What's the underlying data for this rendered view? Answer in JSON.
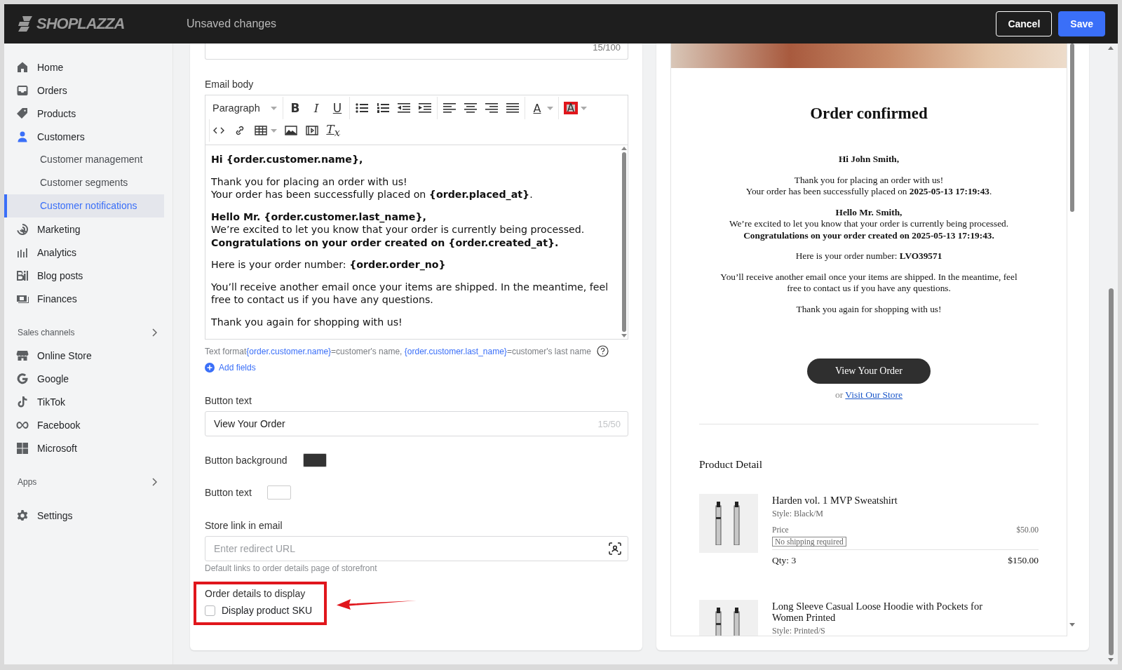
{
  "header": {
    "logo": "SHOPLAZZA",
    "status": "Unsaved changes",
    "buttons": [
      {
        "label": "Cancel",
        "kind": "secondary"
      },
      {
        "label": "Save",
        "kind": "primary"
      }
    ]
  },
  "sidebar": {
    "items": [
      {
        "label": "Home",
        "selected": false,
        "expanded": false
      },
      {
        "label": "Orders",
        "selected": false,
        "expanded": false
      },
      {
        "label": "Products",
        "selected": false,
        "expanded": false
      },
      {
        "label": "Customers",
        "selected": false,
        "expanded": true,
        "children": [
          {
            "label": "Customer management",
            "selected": false
          },
          {
            "label": "Customer segments",
            "selected": false
          },
          {
            "label": "Customer notifications",
            "selected": true
          }
        ]
      },
      {
        "label": "Marketing",
        "selected": false,
        "expanded": false
      },
      {
        "label": "Analytics",
        "selected": false,
        "expanded": false
      },
      {
        "label": "Blog posts",
        "selected": false,
        "expanded": false
      },
      {
        "label": "Finances",
        "selected": false,
        "expanded": false
      }
    ],
    "sections": [
      {
        "title": "Sales channels",
        "items": [
          {
            "label": "Online Store",
            "selected": false
          },
          {
            "label": "Google",
            "selected": false
          },
          {
            "label": "TikTok",
            "selected": false
          },
          {
            "label": "Facebook",
            "selected": false
          },
          {
            "label": "Microsoft",
            "selected": false
          }
        ]
      },
      {
        "title": "Apps"
      }
    ],
    "settings": {
      "label": "Settings",
      "selected": false
    }
  },
  "form": {
    "subject_counter": "15/100",
    "email_body_label": "Email body",
    "toolbar": {
      "block_format": "Paragraph",
      "groups": [
        [
          {
            "kind": "bold",
            "label": "B"
          },
          {
            "kind": "italic",
            "label": "I"
          },
          {
            "kind": "underline",
            "label": "U"
          }
        ],
        [
          {
            "kind": "bullets"
          },
          {
            "kind": "numbers"
          },
          {
            "kind": "outdent"
          },
          {
            "kind": "indent"
          }
        ],
        [
          {
            "kind": "align-left"
          },
          {
            "kind": "align-center"
          },
          {
            "kind": "align-right"
          },
          {
            "kind": "justify"
          }
        ],
        [
          {
            "kind": "text-color",
            "label": "A",
            "dropdown": true
          }
        ],
        [
          {
            "kind": "highlight",
            "label": "A",
            "dropdown": true
          }
        ]
      ],
      "second_row": [
        {
          "kind": "code"
        },
        {
          "kind": "link"
        },
        {
          "kind": "table",
          "dropdown": true
        },
        {
          "kind": "image"
        },
        {
          "kind": "video"
        },
        {
          "kind": "clear",
          "label": "T$_{x}$"
        }
      ]
    },
    "body": [
      [
        {
          "text": "Hi {order.customer.name},",
          "bold": true
        }
      ],
      [
        {
          "text": "Thank you for placing an order with us!",
          "bold": false
        },
        {
          "text": "Your order has been successfully placed on **{order.placed_at}**.",
          "bold": false
        }
      ],
      [
        {
          "text": "Hello Mr. {order.customer.last_name},",
          "bold": true
        },
        {
          "text": "We’re excited to let you know that your order is currently being processed.",
          "bold": false
        },
        {
          "text": "Congratulations on your order created on {order.created_at}.",
          "bold": true
        }
      ],
      [
        {
          "text": "Here is your order number: **{order.order_no}**",
          "bold": false
        }
      ],
      [
        {
          "text": "You’ll receive another email once your items are shipped. In the meantime, feel free to contact us if you have any questions.",
          "bold": false
        }
      ],
      [
        {
          "text": "Thank you again for shopping with us!",
          "bold": false
        }
      ]
    ],
    "format_hint": [
      {
        "text": "Text format",
        "kind": "plain"
      },
      {
        "text": "{order.customer.name}",
        "kind": "variable"
      },
      {
        "text": "=customer's name, ",
        "kind": "plain"
      },
      {
        "text": "{order.customer.last_name}",
        "kind": "variable"
      },
      {
        "text": "=customer's last name",
        "kind": "plain"
      }
    ],
    "add_fields": "Add fields",
    "button_text": {
      "label": "Button text",
      "value": "View Your Order",
      "counter": "15/50"
    },
    "colors": [
      {
        "label": "Button background",
        "color": "#333333"
      },
      {
        "label": "Button text",
        "color": "#ffffff"
      }
    ],
    "store_link": {
      "label": "Store link in email",
      "placeholder": "Enter redirect URL",
      "help": "Default links to order details page of storefront"
    },
    "order_details": {
      "label": "Order details to display",
      "options": [
        {
          "label": "Display product SKU",
          "checked": false
        }
      ]
    }
  },
  "preview": {
    "title": "Order confirmed",
    "paragraphs": [
      [
        {
          "text": "Hi John Smith,",
          "bold": true
        }
      ],
      [
        {
          "text": "Thank you for placing an order with us!",
          "bold": false
        },
        {
          "text": "Your order has been successfully placed on **2025-05-13 17:19:43**.",
          "bold": false
        }
      ],
      [
        {
          "text": "Hello Mr. Smith,",
          "bold": true
        },
        {
          "text": "We’re excited to let you know that your order is currently being processed.",
          "bold": false
        },
        {
          "text": "Congratulations on your order created on 2025-05-13 17:19:43.",
          "bold": true
        }
      ],
      [
        {
          "text": "Here is your order number: **LVO39571**",
          "bold": false
        }
      ],
      [
        {
          "text": "You’ll receive another email once your items are shipped. In the meantime, feel free to contact us if you have any questions.",
          "bold": false
        }
      ],
      [
        {
          "text": "Thank you again for shopping with us!",
          "bold": false
        }
      ]
    ],
    "button": "View Your Order",
    "alt_prefix": "or",
    "alt_link": "Visit Our Store",
    "section_title": "Product Detail",
    "products": [
      {
        "name": "Harden vol. 1 MVP Sweatshirt",
        "style": "Style: Black/M",
        "price_label": "Price",
        "price": "$50.00",
        "badge": "No shipping required",
        "qty": "Qty: 3",
        "total": "$150.00"
      },
      {
        "name": "Long Sleeve Casual Loose Hoodie with Pockets for Women Printed",
        "style": "Style: Printed/S"
      }
    ]
  }
}
